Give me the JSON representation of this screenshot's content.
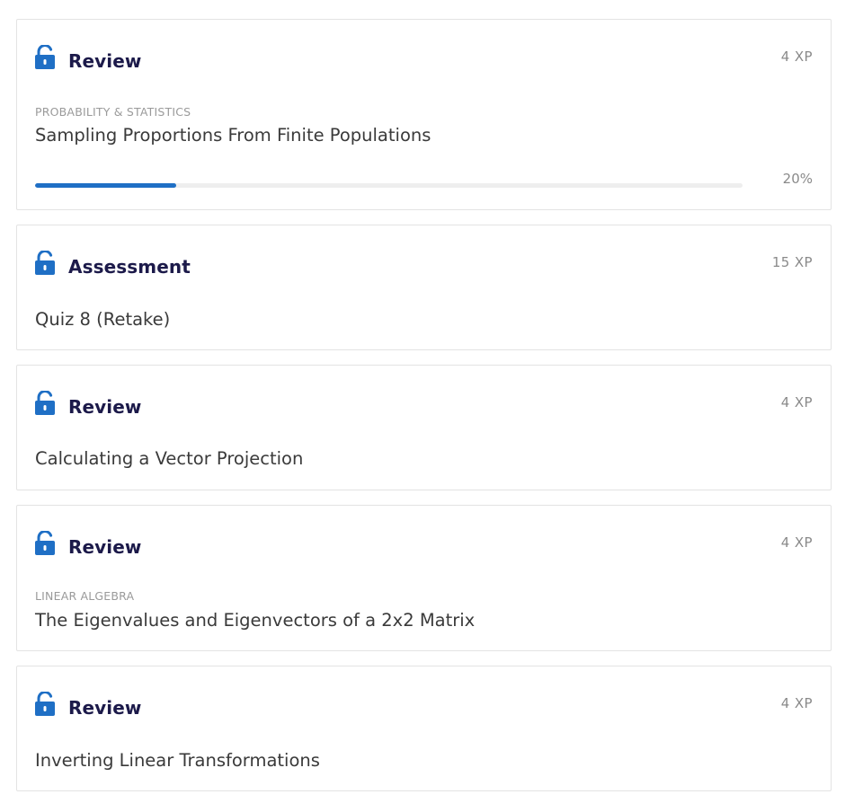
{
  "colors": {
    "accent": "#1f6fc5",
    "heading": "#1c1a4a",
    "muted": "#8a8a8a"
  },
  "cards": [
    {
      "icon": "unlocked-padlock-icon",
      "kind": "Review",
      "xp": "4 XP",
      "category": "PROBABILITY & STATISTICS",
      "title": "Sampling Proportions From Finite Populations",
      "progress": 0.2,
      "progress_label": "20%"
    },
    {
      "icon": "unlocked-padlock-icon",
      "kind": "Assessment",
      "xp": "15 XP",
      "title": "Quiz 8 (Retake)"
    },
    {
      "icon": "unlocked-padlock-icon",
      "kind": "Review",
      "xp": "4 XP",
      "title": "Calculating a Vector Projection"
    },
    {
      "icon": "unlocked-padlock-icon",
      "kind": "Review",
      "xp": "4 XP",
      "category": "LINEAR ALGEBRA",
      "title": "The Eigenvalues and Eigenvectors of a 2x2 Matrix"
    },
    {
      "icon": "unlocked-padlock-icon",
      "kind": "Review",
      "xp": "4 XP",
      "title": "Inverting Linear Transformations"
    }
  ]
}
